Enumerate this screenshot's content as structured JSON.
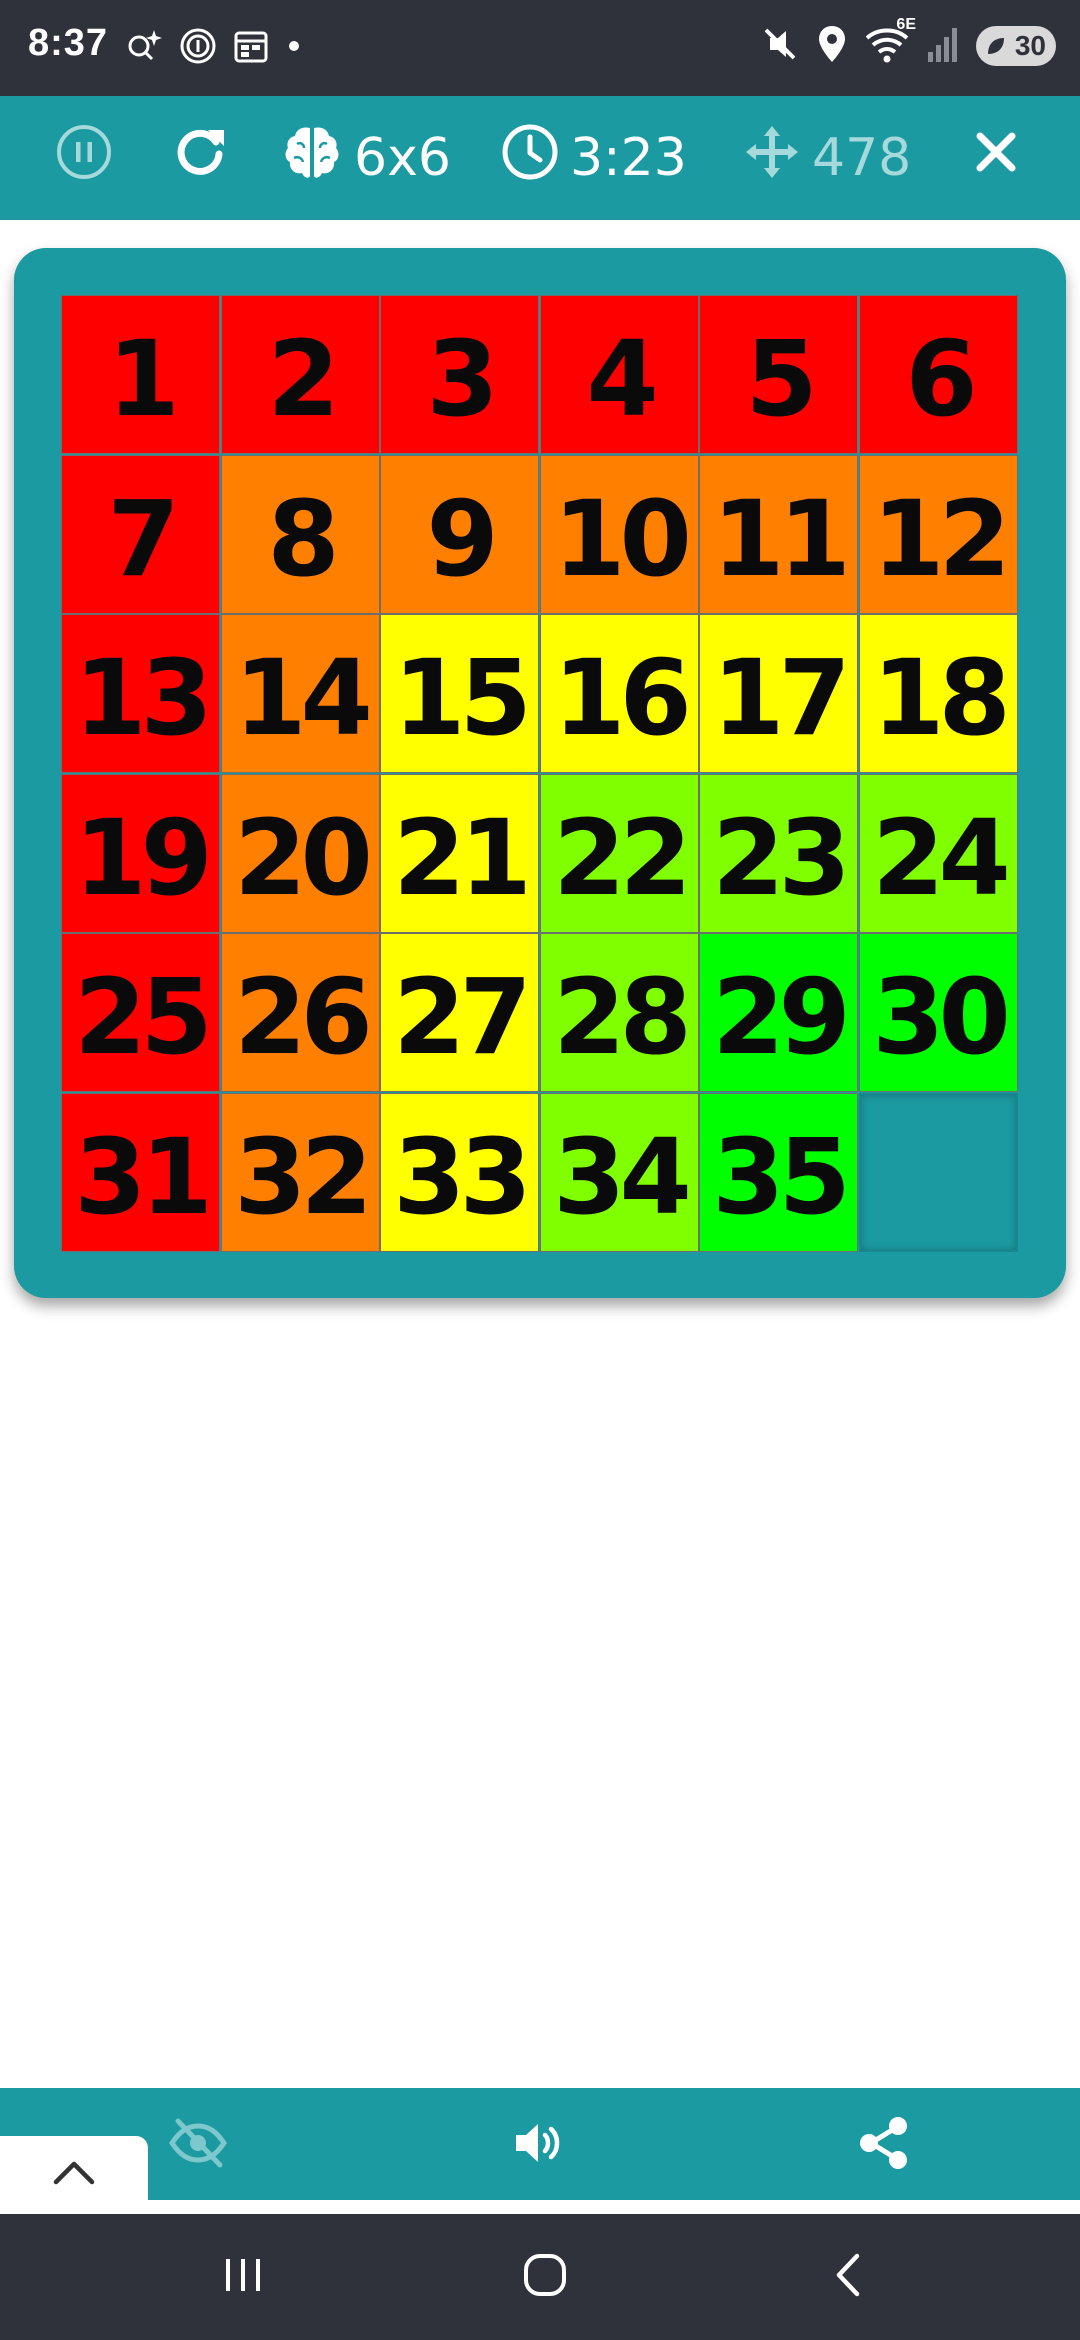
{
  "status_bar": {
    "time": "8:37",
    "network": "6E",
    "battery": "30",
    "left_icons": [
      "assistant-sparkle-icon",
      "nfc-icon",
      "calendar-icon",
      "dot-icon"
    ],
    "right_icons": [
      "mute-icon",
      "location-icon",
      "wifi-icon",
      "signal-icon",
      "battery-icon"
    ]
  },
  "toolbar": {
    "board_size": "6x6",
    "timer": "3:23",
    "moves": "478",
    "icons": [
      "pause-icon",
      "restart-icon",
      "brain-icon",
      "clock-icon",
      "move-icon",
      "close-icon"
    ]
  },
  "puzzle": {
    "rows": 6,
    "cols": 6,
    "tiles": [
      {
        "label": "1",
        "color": "#ff0000"
      },
      {
        "label": "2",
        "color": "#ff0000"
      },
      {
        "label": "3",
        "color": "#ff0000"
      },
      {
        "label": "4",
        "color": "#ff0000"
      },
      {
        "label": "5",
        "color": "#ff0000"
      },
      {
        "label": "6",
        "color": "#ff0000"
      },
      {
        "label": "7",
        "color": "#ff0000"
      },
      {
        "label": "8",
        "color": "#ff8000"
      },
      {
        "label": "9",
        "color": "#ff8000"
      },
      {
        "label": "10",
        "color": "#ff8000"
      },
      {
        "label": "11",
        "color": "#ff8000"
      },
      {
        "label": "12",
        "color": "#ff8000"
      },
      {
        "label": "13",
        "color": "#ff0000"
      },
      {
        "label": "14",
        "color": "#ff8000"
      },
      {
        "label": "15",
        "color": "#ffff00"
      },
      {
        "label": "16",
        "color": "#ffff00"
      },
      {
        "label": "17",
        "color": "#ffff00"
      },
      {
        "label": "18",
        "color": "#ffff00"
      },
      {
        "label": "19",
        "color": "#ff0000"
      },
      {
        "label": "20",
        "color": "#ff8000"
      },
      {
        "label": "21",
        "color": "#ffff00"
      },
      {
        "label": "22",
        "color": "#80ff00"
      },
      {
        "label": "23",
        "color": "#80ff00"
      },
      {
        "label": "24",
        "color": "#80ff00"
      },
      {
        "label": "25",
        "color": "#ff0000"
      },
      {
        "label": "26",
        "color": "#ff8000"
      },
      {
        "label": "27",
        "color": "#ffff00"
      },
      {
        "label": "28",
        "color": "#80ff00"
      },
      {
        "label": "29",
        "color": "#00ff00"
      },
      {
        "label": "30",
        "color": "#00ff00"
      },
      {
        "label": "31",
        "color": "#ff0000"
      },
      {
        "label": "32",
        "color": "#ff8000"
      },
      {
        "label": "33",
        "color": "#ffff00"
      },
      {
        "label": "34",
        "color": "#80ff00"
      },
      {
        "label": "35",
        "color": "#00ff00"
      }
    ],
    "empty_slot": {
      "row": 6,
      "col": 6
    }
  },
  "bottom_bar": {
    "icons": [
      "chevron-up-icon",
      "hide-icon",
      "volume-icon",
      "share-icon"
    ]
  },
  "nav_bar": {
    "icons": [
      "recents-icon",
      "home-icon",
      "back-icon"
    ]
  },
  "colors": {
    "teal": "#1c9aa1",
    "system_bar": "#2f323a"
  }
}
